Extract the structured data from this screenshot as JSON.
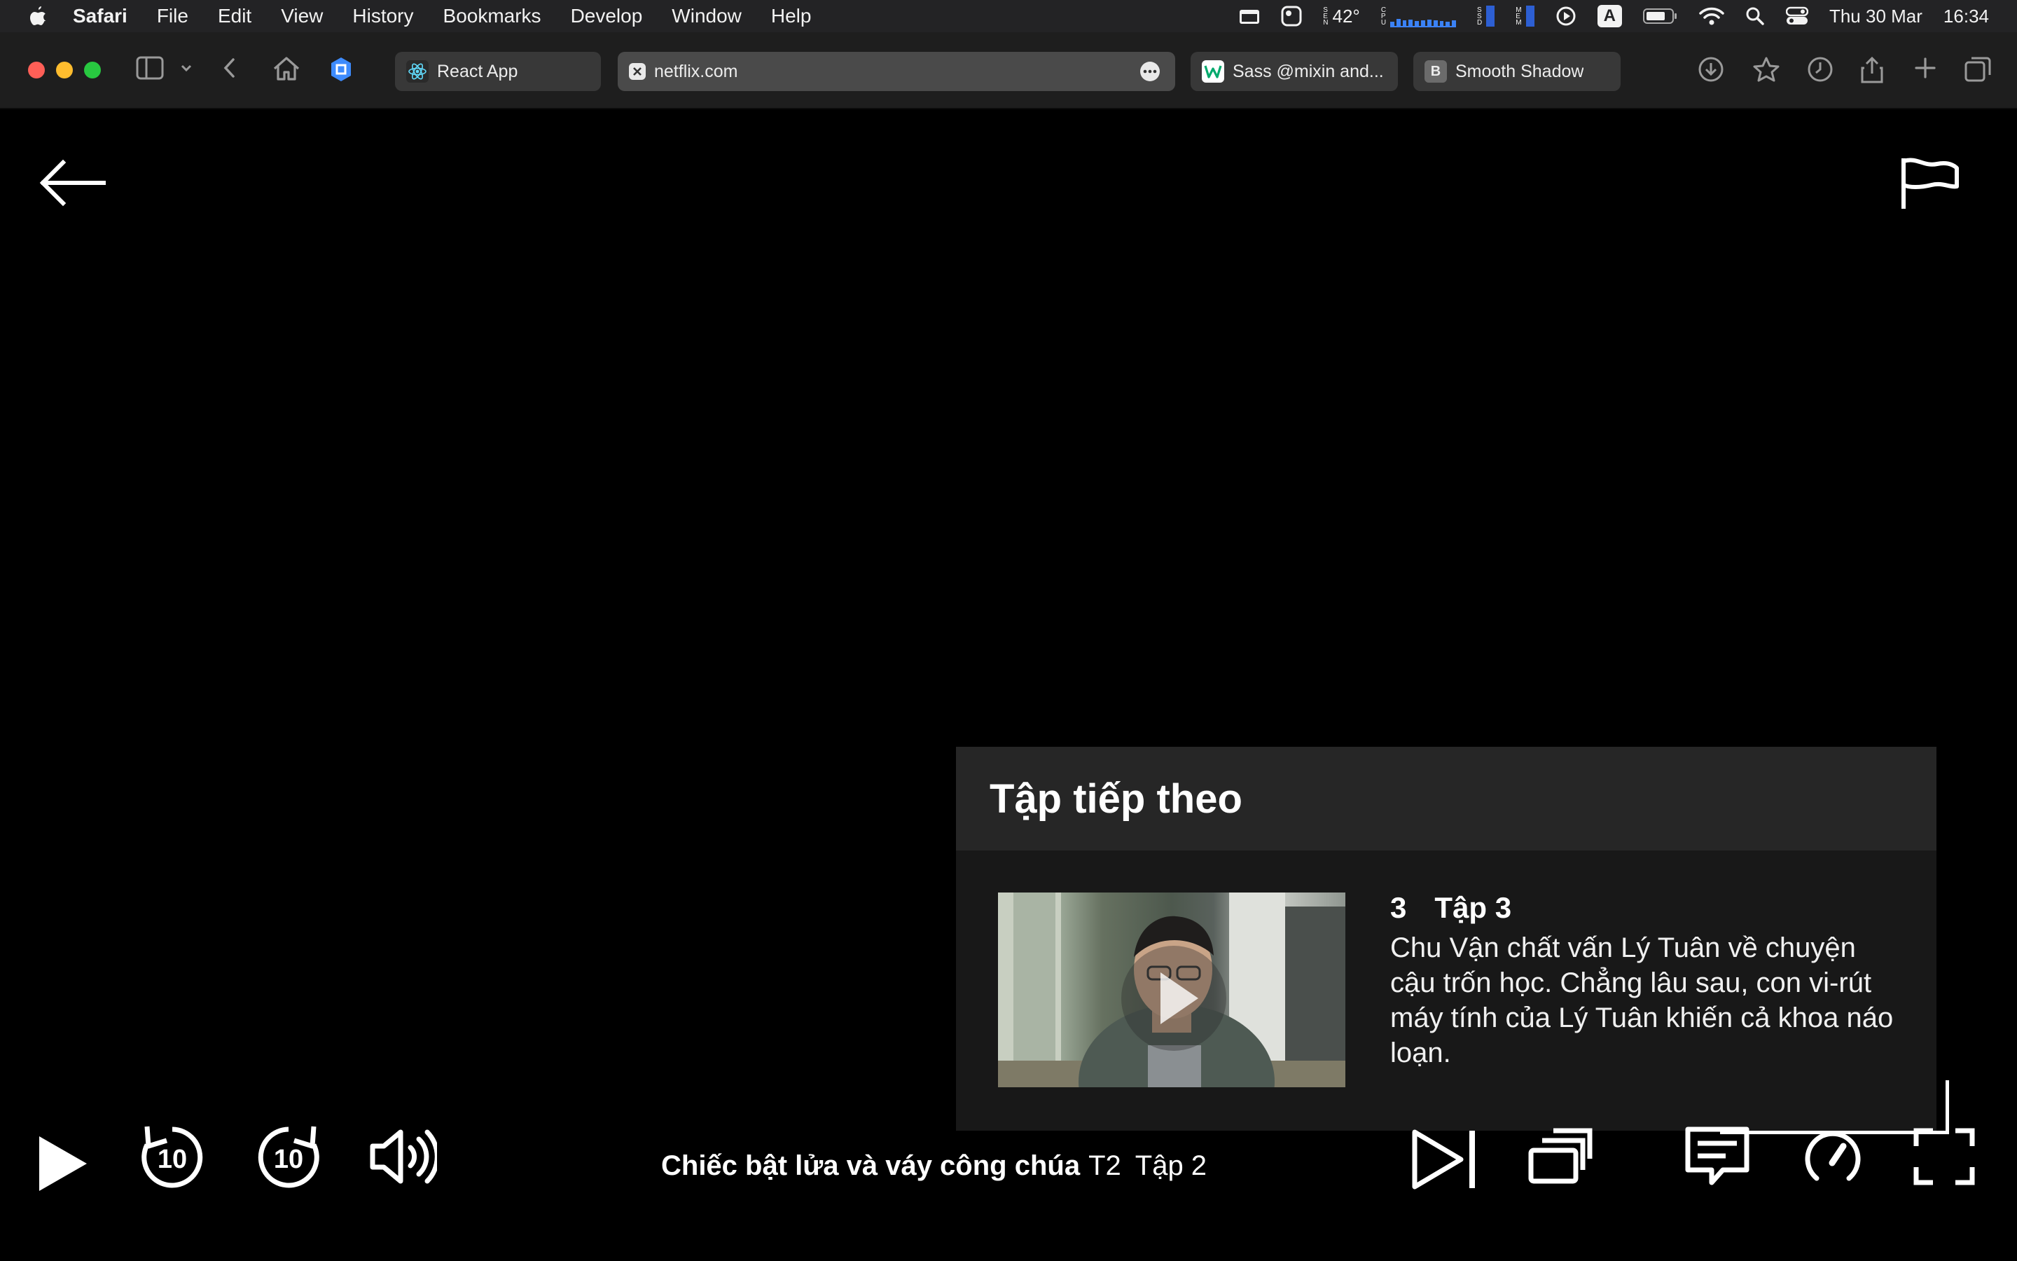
{
  "menubar": {
    "app_name": "Safari",
    "items": [
      "File",
      "Edit",
      "View",
      "History",
      "Bookmarks",
      "Develop",
      "Window",
      "Help"
    ],
    "temperature": "42°",
    "date": "Thu 30 Mar",
    "time": "16:34",
    "input_source": "A"
  },
  "browser": {
    "tabs": [
      {
        "label": "React App",
        "icon": "react-icon"
      },
      {
        "label": "netflix.com",
        "icon": "netflix-favicon",
        "active": true
      },
      {
        "label": "Sass @mixin and...",
        "icon": "w-favicon"
      },
      {
        "label": "Smooth Shadow",
        "icon": "b-favicon"
      }
    ],
    "icons": {
      "b_favicon_letter": "B"
    }
  },
  "player": {
    "next_card": {
      "heading": "Tập tiếp theo",
      "episode_number": "3",
      "episode_title": "Tập 3",
      "description": "Chu Vận chất vấn Lý Tuân về chuyện cậu trốn học. Chẳng lâu sau, con vi-rút máy tính của Lý Tuân khiến cả khoa náo loạn."
    },
    "now_playing": {
      "show": "Chiếc bật lửa và váy công chúa",
      "season": "T2",
      "episode": "Tập 2"
    },
    "skip_seconds": "10",
    "colors": {
      "background": "#000000",
      "card": "#181818",
      "card_header": "#262626"
    }
  }
}
